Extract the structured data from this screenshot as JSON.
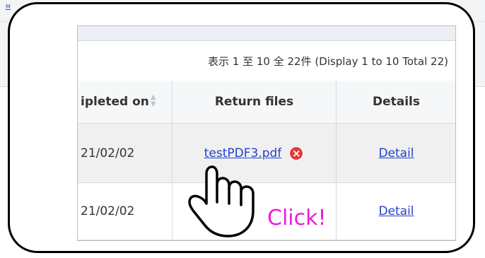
{
  "background": {
    "top_link": "M"
  },
  "summary": "表示 1 至 10 全 22件 (Display 1 to 10 Total 22)",
  "headers": {
    "completed_on": "ipleted on",
    "return_files": "Return files",
    "details": "Details"
  },
  "rows": [
    {
      "completed_on": "21/02/02",
      "return_file": "testPDF3.pdf",
      "details": "Detail"
    },
    {
      "completed_on": "21/02/02",
      "return_file": "",
      "details": "Detail"
    }
  ],
  "overlay": {
    "click_label": "Click!"
  },
  "colors": {
    "link": "#2341c9",
    "delete": "#e13a3a",
    "click_text": "#f01ad9"
  },
  "icons": {
    "sort": "sort-icon",
    "delete": "delete-icon",
    "hand": "hand-pointer-icon"
  }
}
